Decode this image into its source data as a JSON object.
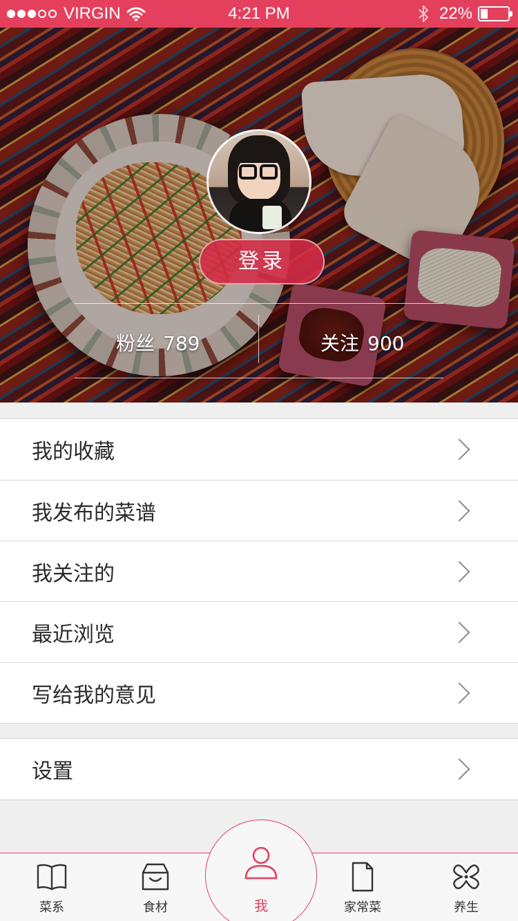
{
  "status_bar": {
    "carrier": "VIRGIN",
    "time": "4:21 PM",
    "battery": "22%"
  },
  "profile": {
    "login_label": "登录",
    "fans": {
      "label": "粉丝",
      "count": "789"
    },
    "following": {
      "label": "关注",
      "count": "900"
    }
  },
  "menu": {
    "group1": [
      {
        "label": "我的收藏"
      },
      {
        "label": "我发布的菜谱"
      },
      {
        "label": "我关注的"
      },
      {
        "label": "最近浏览"
      },
      {
        "label": "写给我的意见"
      }
    ],
    "group2": [
      {
        "label": "设置"
      }
    ]
  },
  "tabs": [
    {
      "label": "菜系",
      "icon": "book-icon"
    },
    {
      "label": "食材",
      "icon": "basket-icon"
    },
    {
      "label": "我",
      "icon": "user-icon",
      "active": true
    },
    {
      "label": "家常菜",
      "icon": "document-icon"
    },
    {
      "label": "养生",
      "icon": "clover-icon"
    }
  ],
  "colors": {
    "accent": "#e4405d",
    "text": "#2a2a2a",
    "background": "#efefef"
  }
}
